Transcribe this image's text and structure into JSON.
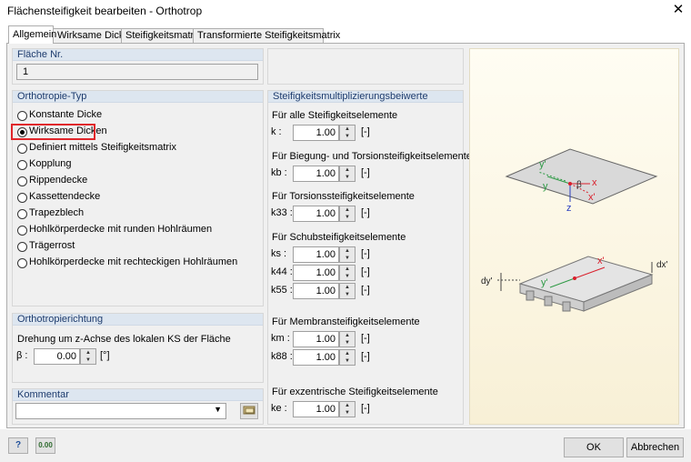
{
  "window": {
    "title": "Flächensteifigkeit bearbeiten - Orthotrop",
    "close_glyph": "✕"
  },
  "tabs": [
    "Allgemein",
    "Wirksame Dicke",
    "Steifigkeitsmatrix",
    "Transformierte Steifigkeitsmatrix"
  ],
  "flaeche": {
    "header": "Fläche Nr.",
    "value": "1"
  },
  "orthotropie": {
    "header": "Orthotropie-Typ",
    "options": [
      "Konstante Dicke",
      "Wirksame Dicken",
      "Definiert mittels Steifigkeitsmatrix",
      "Kopplung",
      "Rippendecke",
      "Kassettendecke",
      "Trapezblech",
      "Hohlkörperdecke mit runden Hohlräumen",
      "Trägerrost",
      "Hohlkörperdecke mit rechteckigen Hohlräumen"
    ],
    "selected": "Wirksame Dicken"
  },
  "richtung": {
    "header": "Orthotropierichtung",
    "desc": "Drehung um z-Achse des lokalen KS der Fläche",
    "label": "β :",
    "value": "0.00",
    "unit": "[°]"
  },
  "kommentar": {
    "header": "Kommentar",
    "value": ""
  },
  "beiwerte": {
    "header": "Steifigkeitsmultiplizierungsbeiwerte",
    "sections": [
      {
        "title": "Für alle Steifigkeitselemente",
        "rows": [
          {
            "label": "k :",
            "value": "1.00",
            "unit": "[-]"
          }
        ]
      },
      {
        "title": "Für Biegung- und Torsionsteifigkeitselemente",
        "rows": [
          {
            "label": "kb :",
            "value": "1.00",
            "unit": "[-]"
          }
        ]
      },
      {
        "title": "Für Torsionssteifigkeitselemente",
        "rows": [
          {
            "label": "k33 :",
            "value": "1.00",
            "unit": "[-]"
          }
        ]
      },
      {
        "title": "Für Schubsteifigkeitselemente",
        "rows": [
          {
            "label": "ks :",
            "value": "1.00",
            "unit": "[-]"
          },
          {
            "label": "k44 :",
            "value": "1.00",
            "unit": "[-]"
          },
          {
            "label": "k55 :",
            "value": "1.00",
            "unit": "[-]"
          }
        ]
      },
      {
        "title": "Für Membransteifigkeitselemente",
        "rows": [
          {
            "label": "km :",
            "value": "1.00",
            "unit": "[-]"
          },
          {
            "label": "k88 :",
            "value": "1.00",
            "unit": "[-]"
          }
        ]
      },
      {
        "title": "Für exzentrische Steifigkeitselemente",
        "rows": [
          {
            "label": "ke :",
            "value": "1.00",
            "unit": "[-]"
          }
        ]
      }
    ]
  },
  "diagram": {
    "plate_labels": [
      "y'",
      "y",
      "β",
      "x",
      "x'",
      "z"
    ],
    "slab_labels": [
      "y'",
      "x'",
      "dy'",
      "dx'"
    ]
  },
  "buttons": {
    "ok": "OK",
    "cancel": "Abbrechen",
    "help_glyph": "?",
    "units_glyph": "0.00"
  },
  "colors": {
    "highlight": "#e0262b",
    "group_header": "#dde6f0",
    "x_axis": "#d9202c",
    "y_axis": "#2e9a45",
    "z_axis": "#2a3fbf",
    "diagram_bg": "#fcf7e4"
  }
}
